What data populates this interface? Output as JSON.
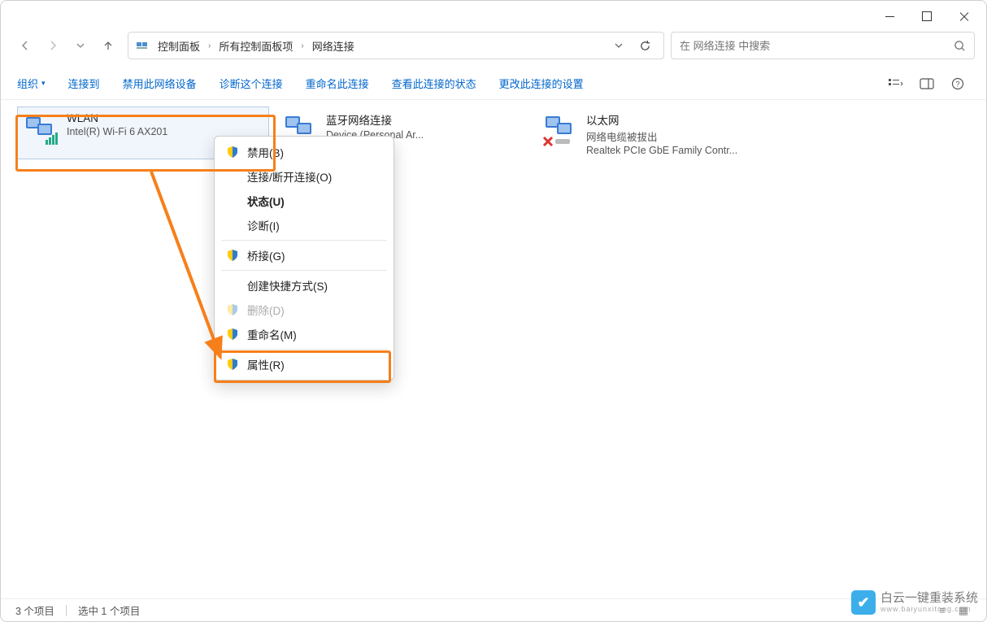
{
  "breadcrumb": {
    "items": [
      "控制面板",
      "所有控制面板项",
      "网络连接"
    ]
  },
  "search": {
    "placeholder": "在 网络连接 中搜索"
  },
  "toolbar": {
    "organize": "组织",
    "connect_to": "连接到",
    "disable_device": "禁用此网络设备",
    "diagnose": "诊断这个连接",
    "rename": "重命名此连接",
    "view_status": "查看此连接的状态",
    "change_settings": "更改此连接的设置"
  },
  "adapters": [
    {
      "name": "WLAN",
      "status": "",
      "device": "Intel(R) Wi-Fi 6 AX201",
      "selected": true,
      "kind": "wifi"
    },
    {
      "name": "蓝牙网络连接",
      "status": "",
      "device": "Device (Personal Ar...",
      "selected": false,
      "kind": "bluetooth"
    },
    {
      "name": "以太网",
      "status": "网络电缆被拔出",
      "device": "Realtek PCIe GbE Family Contr...",
      "selected": false,
      "kind": "ethernet-disconnected"
    }
  ],
  "context_menu": {
    "disable": "禁用(B)",
    "connect_disconnect": "连接/断开连接(O)",
    "status": "状态(U)",
    "diagnose": "诊断(I)",
    "bridge": "桥接(G)",
    "shortcut": "创建快捷方式(S)",
    "delete": "删除(D)",
    "rename": "重命名(M)",
    "properties": "属性(R)"
  },
  "statusbar": {
    "item_count": "3 个项目",
    "selected": "选中 1 个项目"
  },
  "watermark": {
    "text": "白云一键重装系统",
    "url": "www.baiyunxitong.com"
  },
  "colors": {
    "highlight": "#f77f1a",
    "link": "#0066cc"
  }
}
